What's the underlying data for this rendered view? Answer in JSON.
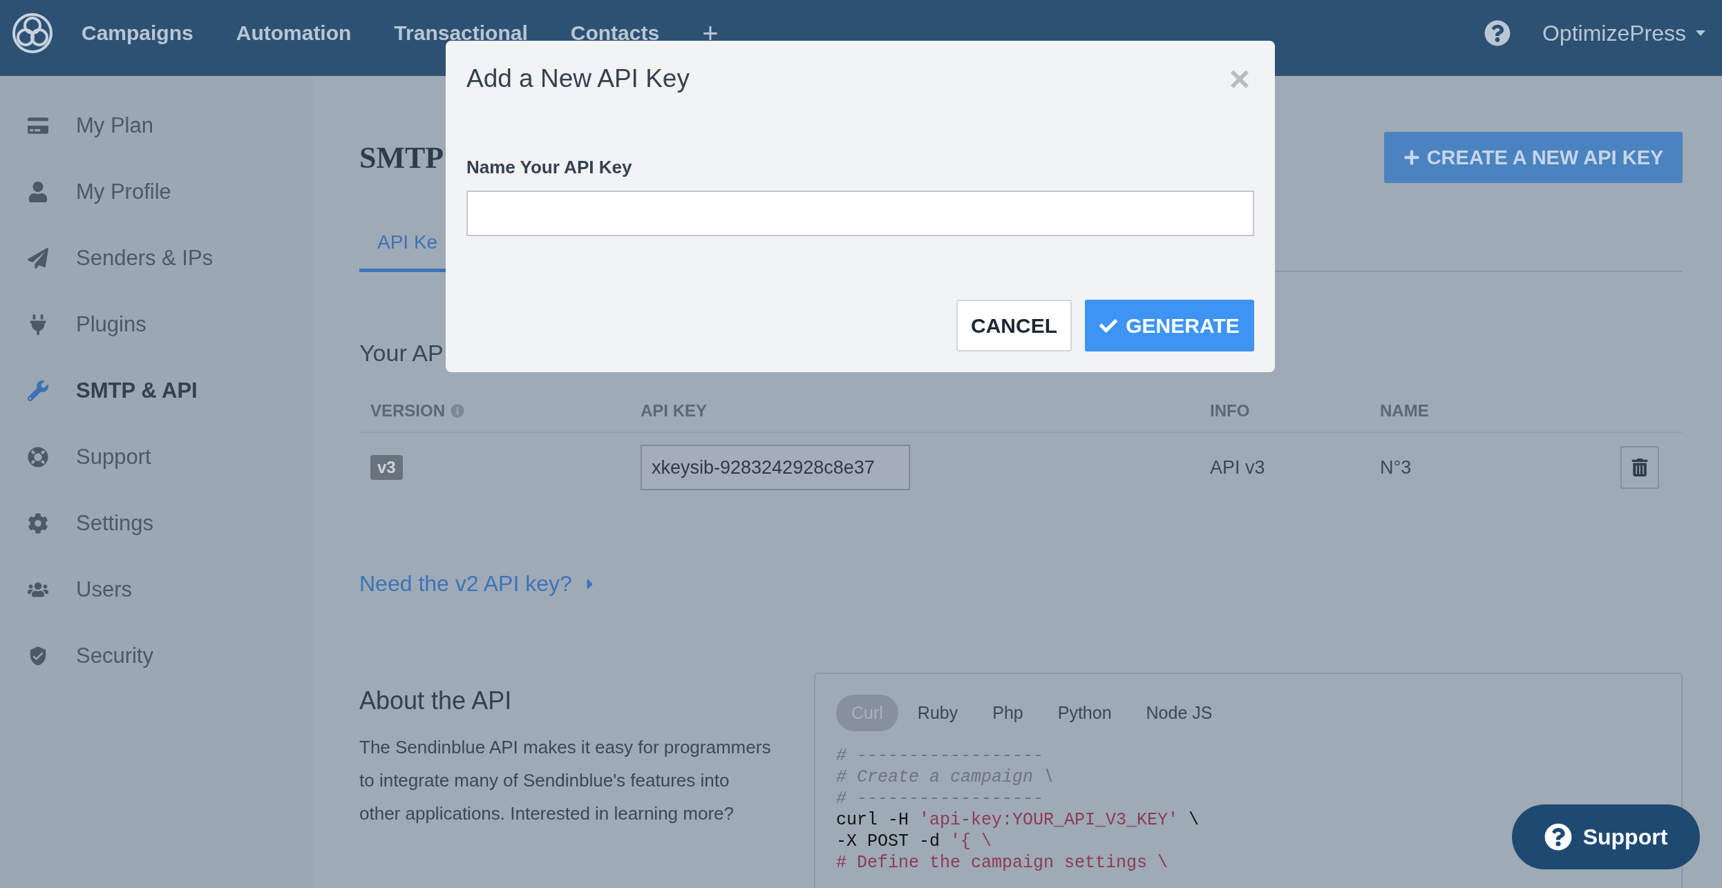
{
  "nav": {
    "items": [
      {
        "label": "Campaigns"
      },
      {
        "label": "Automation"
      },
      {
        "label": "Transactional"
      },
      {
        "label": "Contacts"
      },
      {
        "label": "+"
      }
    ],
    "account": "OptimizePress"
  },
  "sidebar": {
    "items": [
      {
        "label": "My Plan",
        "selected": false
      },
      {
        "label": "My Profile",
        "selected": false
      },
      {
        "label": "Senders & IPs",
        "selected": false
      },
      {
        "label": "Plugins",
        "selected": false
      },
      {
        "label": "SMTP & API",
        "selected": true
      },
      {
        "label": "Support",
        "selected": false
      },
      {
        "label": "Settings",
        "selected": false
      },
      {
        "label": "Users",
        "selected": false
      },
      {
        "label": "Security",
        "selected": false
      }
    ]
  },
  "page": {
    "title": "SMTP",
    "create_button": "CREATE A NEW API KEY",
    "tabs": [
      {
        "label": "API Ke",
        "selected": true
      }
    ],
    "section_title": "Your AP"
  },
  "table": {
    "columns": [
      "VERSION",
      "API KEY",
      "INFO",
      "NAME"
    ],
    "rows": [
      {
        "version": "v3",
        "api_key": "xkeysib-9283242928c8e37",
        "info": "API v3",
        "name": "N°3"
      }
    ]
  },
  "v2_link": "Need the v2 API key?",
  "about": {
    "title": "About the API",
    "text": "The Sendinblue API makes it easy for programmers to integrate many of Sendinblue's features into other applications. Interested in learning more?"
  },
  "code": {
    "tabs": [
      {
        "label": "Curl",
        "selected": true
      },
      {
        "label": "Ruby",
        "selected": false
      },
      {
        "label": "Php",
        "selected": false
      },
      {
        "label": "Python",
        "selected": false
      },
      {
        "label": "Node JS",
        "selected": false
      }
    ],
    "lines": [
      [
        {
          "kind": "comment",
          "text": "# ------------------"
        }
      ],
      [
        {
          "kind": "comment",
          "text": "# Create a campaign \\"
        }
      ],
      [
        {
          "kind": "comment",
          "text": "# ------------------"
        }
      ],
      [
        {
          "kind": "plain",
          "text": "curl -H "
        },
        {
          "kind": "string",
          "text": "'api-key:YOUR_API_V3_KEY'"
        },
        {
          "kind": "plain",
          "text": " \\"
        }
      ],
      [
        {
          "kind": "plain",
          "text": "-X POST -d "
        },
        {
          "kind": "string",
          "text": "'{ \\"
        }
      ],
      [
        {
          "kind": "string",
          "text": "# Define the campaign settings \\"
        }
      ]
    ]
  },
  "modal": {
    "title": "Add a New API Key",
    "close": "×",
    "field_label": "Name Your API Key",
    "cancel": "CANCEL",
    "generate": "GENERATE"
  },
  "support_button": "Support"
}
